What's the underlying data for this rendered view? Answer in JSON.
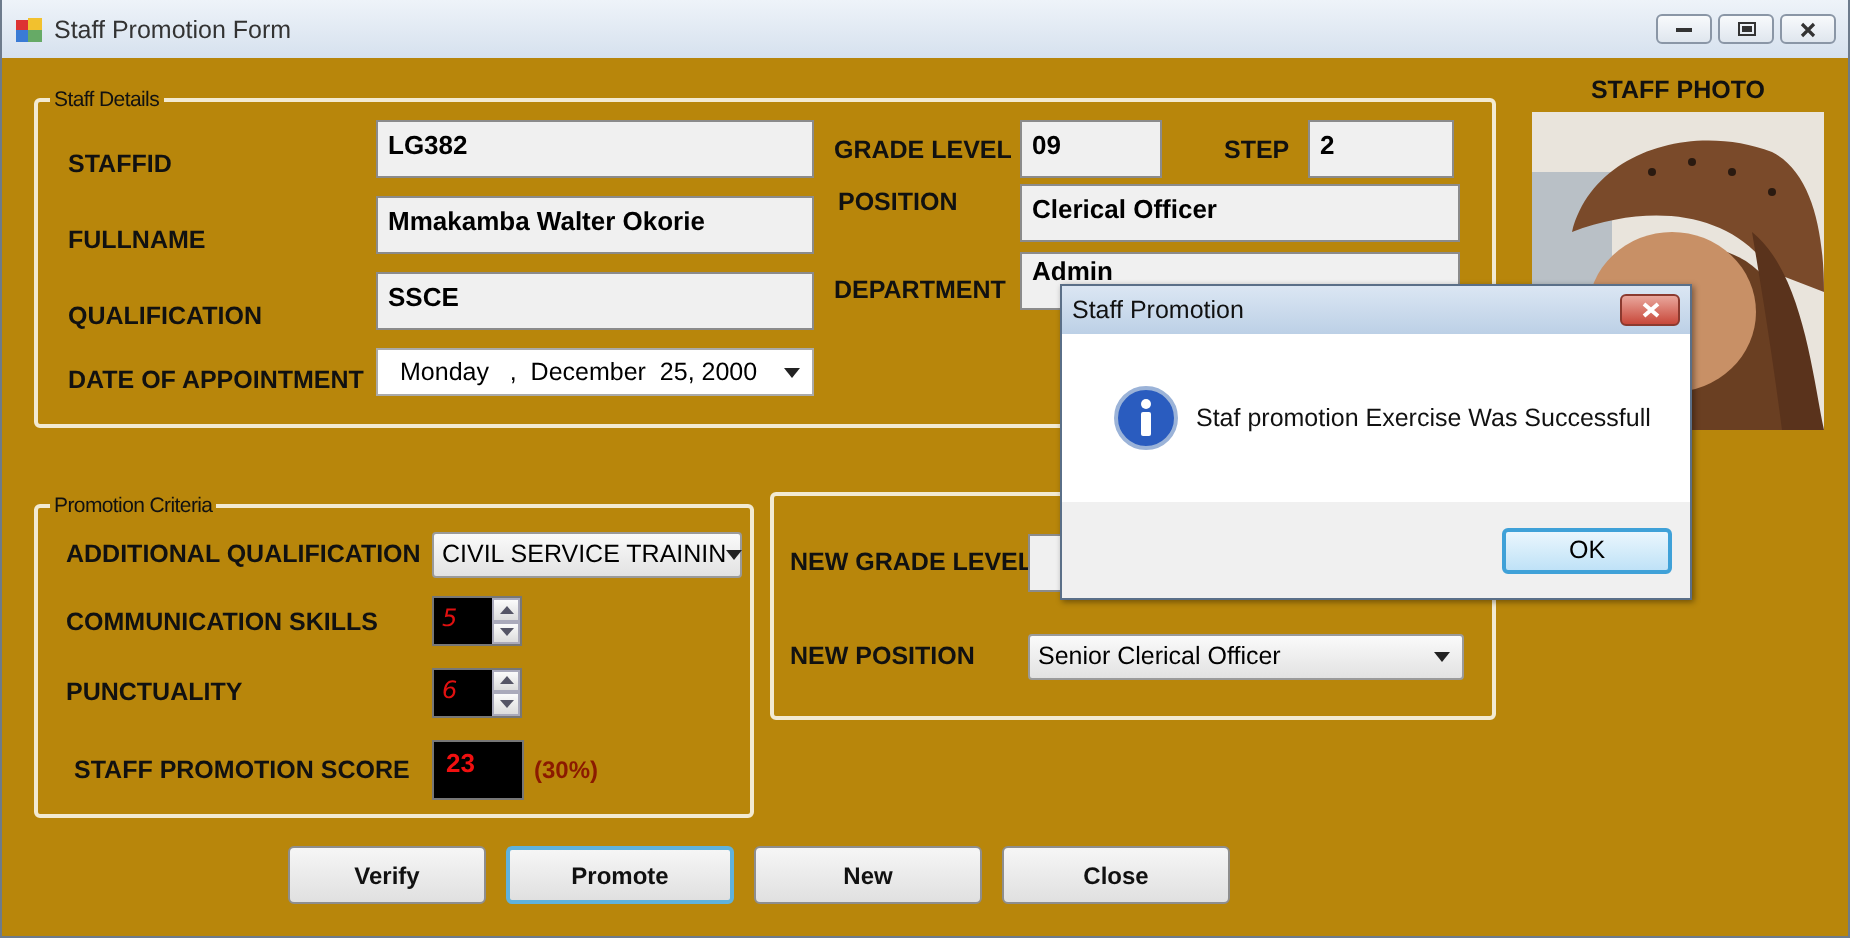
{
  "window": {
    "title": "Staff Promotion Form"
  },
  "staff_details": {
    "title": "Staff Details",
    "left": [
      {
        "kind": "text",
        "label": "STAFFID",
        "value": "LG382"
      },
      {
        "kind": "text",
        "label": "FULLNAME",
        "value": "Mmakamba Walter Okorie"
      },
      {
        "kind": "text",
        "label": "QUALIFICATION",
        "value": "SSCE"
      },
      {
        "kind": "date",
        "label": "DATE OF APPOINTMENT",
        "value": "Monday   ,  December  25, 2000"
      }
    ],
    "grade_level": {
      "label": "GRADE LEVEL",
      "value": "09"
    },
    "step": {
      "label": "STEP",
      "value": "2"
    },
    "position": {
      "label": "POSITION",
      "value": "Clerical Officer"
    },
    "department": {
      "label": "DEPARTMENT",
      "value": "Admin"
    }
  },
  "staff_photo": {
    "label": "STAFF PHOTO",
    "kind": "picture"
  },
  "promotion_criteria": {
    "title": "Promotion Criteria",
    "rows": [
      {
        "kind": "combo",
        "label": "ADDITIONAL QUALIFICATION",
        "value": "CIVIL SERVICE TRAININ"
      },
      {
        "kind": "spinner",
        "label": "COMMUNICATION SKILLS",
        "value": "5"
      },
      {
        "kind": "spinner",
        "label": "PUNCTUALITY",
        "value": "6"
      },
      {
        "kind": "score",
        "label": "STAFF PROMOTION SCORE",
        "value": "23",
        "note": "(30%)"
      }
    ]
  },
  "new_placement": {
    "rows": [
      {
        "kind": "text",
        "label": "NEW GRADE LEVEL"
      },
      {
        "kind": "combo",
        "label": "NEW POSITION",
        "value": "Senior Clerical Officer"
      }
    ]
  },
  "buttons": [
    {
      "label": "Verify",
      "focused": false
    },
    {
      "label": "Promote",
      "focused": true
    },
    {
      "label": "New",
      "focused": false
    },
    {
      "label": "Close",
      "focused": false
    }
  ],
  "dialog": {
    "title": "Staff Promotion",
    "message": "Staf promotion Exercise Was Successfull",
    "button": {
      "label": "OK",
      "focused": true
    }
  }
}
